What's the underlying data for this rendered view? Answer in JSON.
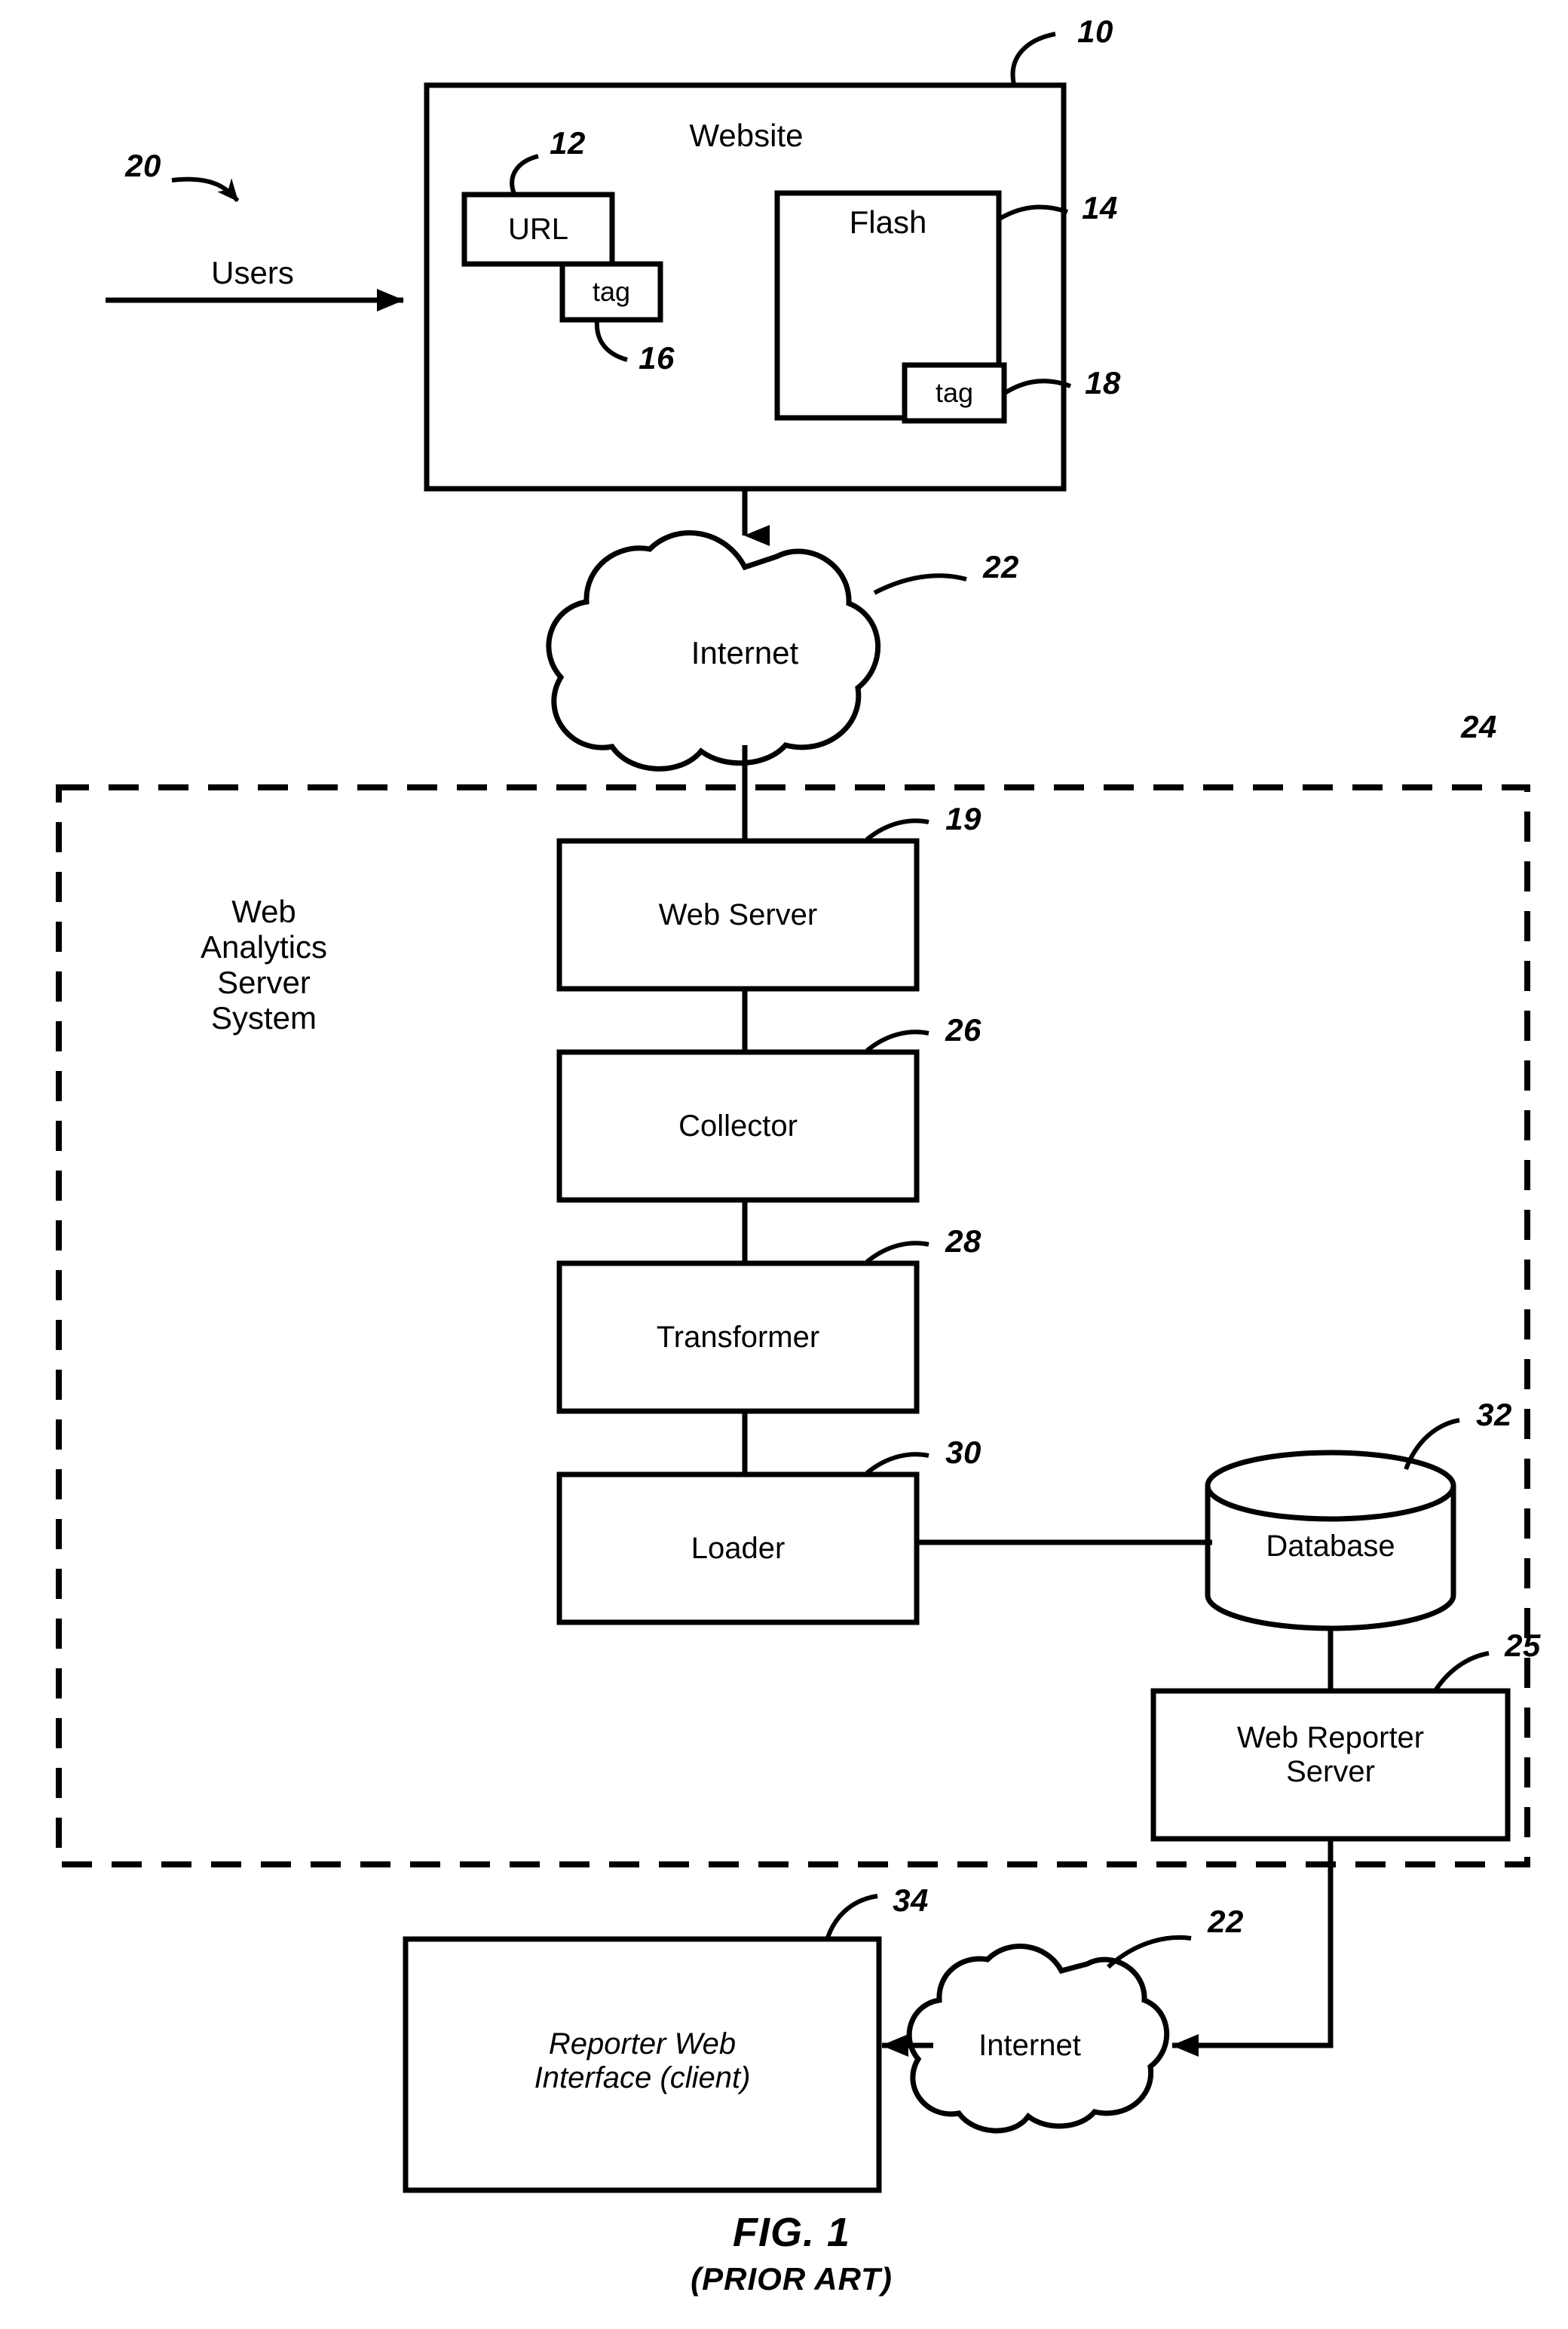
{
  "figure": {
    "caption": "FIG. 1",
    "subcaption": "(PRIOR ART)"
  },
  "nodes": {
    "website": {
      "label": "Website",
      "ref": "10"
    },
    "url": {
      "label": "URL",
      "ref": "12"
    },
    "url_tag": {
      "label": "tag",
      "ref": "16"
    },
    "flash": {
      "label": "Flash",
      "ref": "14"
    },
    "flash_tag": {
      "label": "tag",
      "ref": "18"
    },
    "users": {
      "label": "Users",
      "ref": "20"
    },
    "internet_top": {
      "label": "Internet",
      "ref": "22"
    },
    "system_boundary": {
      "label": "Web\nAnalytics\nServer\nSystem",
      "ref": "24"
    },
    "web_server": {
      "label": "Web Server",
      "ref": "19"
    },
    "collector": {
      "label": "Collector",
      "ref": "26"
    },
    "transformer": {
      "label": "Transformer",
      "ref": "28"
    },
    "loader": {
      "label": "Loader",
      "ref": "30"
    },
    "database": {
      "label": "Database",
      "ref": "32"
    },
    "web_reporter_server": {
      "label": "Web Reporter\nServer",
      "ref": "25"
    },
    "internet_bottom": {
      "label": "Internet",
      "ref": "22"
    },
    "reporter_client": {
      "label": "Reporter Web\nInterface (client)",
      "ref": "34"
    }
  },
  "colors": {
    "stroke": "#000000",
    "fill": "#ffffff",
    "text": "#000000"
  }
}
